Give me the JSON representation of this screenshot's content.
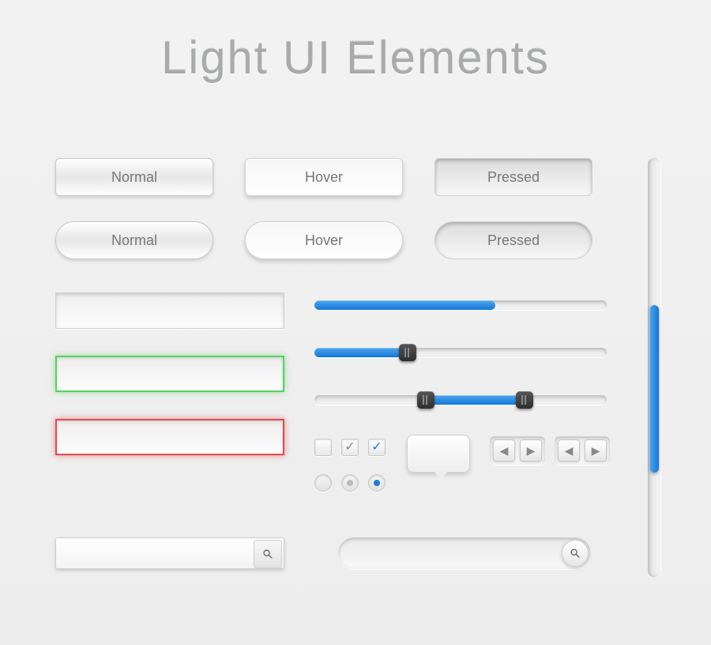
{
  "title": "Light UI Elements",
  "accent": "#1c7ed6",
  "buttons": {
    "rect": [
      {
        "label": "Normal",
        "state": "normal"
      },
      {
        "label": "Hover",
        "state": "hover"
      },
      {
        "label": "Pressed",
        "state": "pressed"
      }
    ],
    "pill": [
      {
        "label": "Normal",
        "state": "normal"
      },
      {
        "label": "Hover",
        "state": "hover"
      },
      {
        "label": "Pressed",
        "state": "pressed"
      }
    ]
  },
  "inputs": {
    "default": "",
    "valid": "",
    "error": ""
  },
  "progress": {
    "percent": 62
  },
  "slider_single": {
    "percent": 32
  },
  "slider_range": {
    "low": 38,
    "high": 72
  },
  "checkboxes": [
    {
      "checked": false
    },
    {
      "checked": true,
      "tick_color": "#888"
    },
    {
      "checked": true,
      "tick_color": "#1c7ed6"
    }
  ],
  "radios": [
    {
      "checked": false
    },
    {
      "checked": true,
      "dot": "#bbb"
    },
    {
      "checked": true,
      "dot": "#1c7ed6"
    }
  ],
  "arrow_groups": [
    {
      "buttons": [
        "◀",
        "▶"
      ]
    },
    {
      "buttons": [
        "◀",
        "▶"
      ]
    }
  ],
  "search": {
    "rect_placeholder": "",
    "pill_placeholder": ""
  },
  "scrollbar": {
    "position": 0.35,
    "size": 0.4
  }
}
